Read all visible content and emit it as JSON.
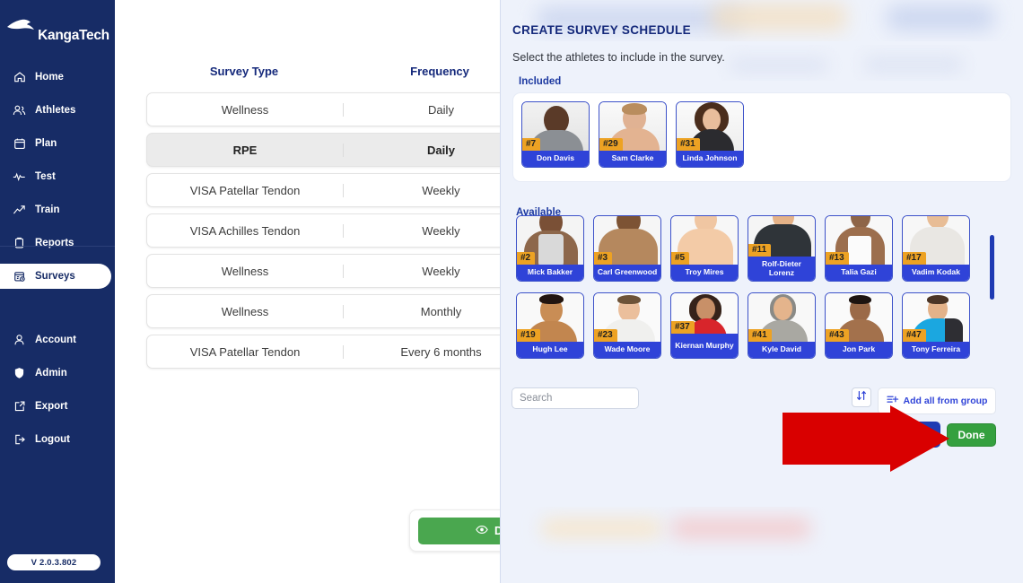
{
  "sidebar": {
    "logo_text": "KangaTech",
    "version": "V 2.0.3.802",
    "items": [
      {
        "label": "Home",
        "icon": "home-icon"
      },
      {
        "label": "Athletes",
        "icon": "athletes-icon"
      },
      {
        "label": "Plan",
        "icon": "calendar-icon"
      },
      {
        "label": "Test",
        "icon": "pulse-icon"
      },
      {
        "label": "Train",
        "icon": "trend-icon"
      },
      {
        "label": "Reports",
        "icon": "clipboard-icon"
      },
      {
        "label": "Surveys",
        "icon": "survey-icon",
        "active": true
      }
    ],
    "bottom_items": [
      {
        "label": "Account",
        "icon": "user-icon"
      },
      {
        "label": "Admin",
        "icon": "shield-icon"
      },
      {
        "label": "Export",
        "icon": "export-icon"
      },
      {
        "label": "Logout",
        "icon": "logout-icon"
      }
    ]
  },
  "table": {
    "columns": [
      "Survey Type",
      "Frequency"
    ],
    "rows": [
      {
        "type": "Wellness",
        "frequency": "Daily",
        "selected": false
      },
      {
        "type": "RPE",
        "frequency": "Daily",
        "selected": true
      },
      {
        "type": "VISA Patellar Tendon",
        "frequency": "Weekly",
        "selected": false
      },
      {
        "type": "VISA Achilles Tendon",
        "frequency": "Weekly",
        "selected": false
      },
      {
        "type": "Wellness",
        "frequency": "Weekly",
        "selected": false
      },
      {
        "type": "Wellness",
        "frequency": "Monthly",
        "selected": false
      },
      {
        "type": "VISA Patellar Tendon",
        "frequency": "Every 6 months",
        "selected": false
      }
    ],
    "details_button": "Details"
  },
  "modal": {
    "title": "CREATE SURVEY SCHEDULE",
    "subtitle": "Select the athletes to include in the survey.",
    "included_label": "Included",
    "available_label": "Available",
    "included": [
      {
        "number": "#7",
        "name": "Don Davis"
      },
      {
        "number": "#29",
        "name": "Sam Clarke"
      },
      {
        "number": "#31",
        "name": "Linda Johnson"
      }
    ],
    "available": [
      {
        "number": "#2",
        "name": "Mick Bakker"
      },
      {
        "number": "#3",
        "name": "Carl Greenwood"
      },
      {
        "number": "#5",
        "name": "Troy Mires"
      },
      {
        "number": "#11",
        "name": "Rolf-Dieter Lorenz"
      },
      {
        "number": "#13",
        "name": "Talia Gazi"
      },
      {
        "number": "#17",
        "name": "Vadim Kodak"
      },
      {
        "number": "#19",
        "name": "Hugh Lee"
      },
      {
        "number": "#23",
        "name": "Wade Moore"
      },
      {
        "number": "#37",
        "name": "Kiernan Murphy"
      },
      {
        "number": "#41",
        "name": "Kyle David"
      },
      {
        "number": "#43",
        "name": "Jon Park"
      },
      {
        "number": "#47",
        "name": "Tony Ferreira"
      }
    ],
    "search_placeholder": "Search",
    "sort_icon": "sort-updown-icon",
    "add_all_label": "Add all from group",
    "done_label": "Done"
  },
  "colors": {
    "sidebar_bg": "#172c66",
    "accent_blue": "#2f43d8",
    "number_badge": "#eda223",
    "done_green": "#35a03f",
    "details_green": "#4aa74f",
    "annotation_red": "#d90000",
    "modal_bg": "#eef2fb"
  }
}
